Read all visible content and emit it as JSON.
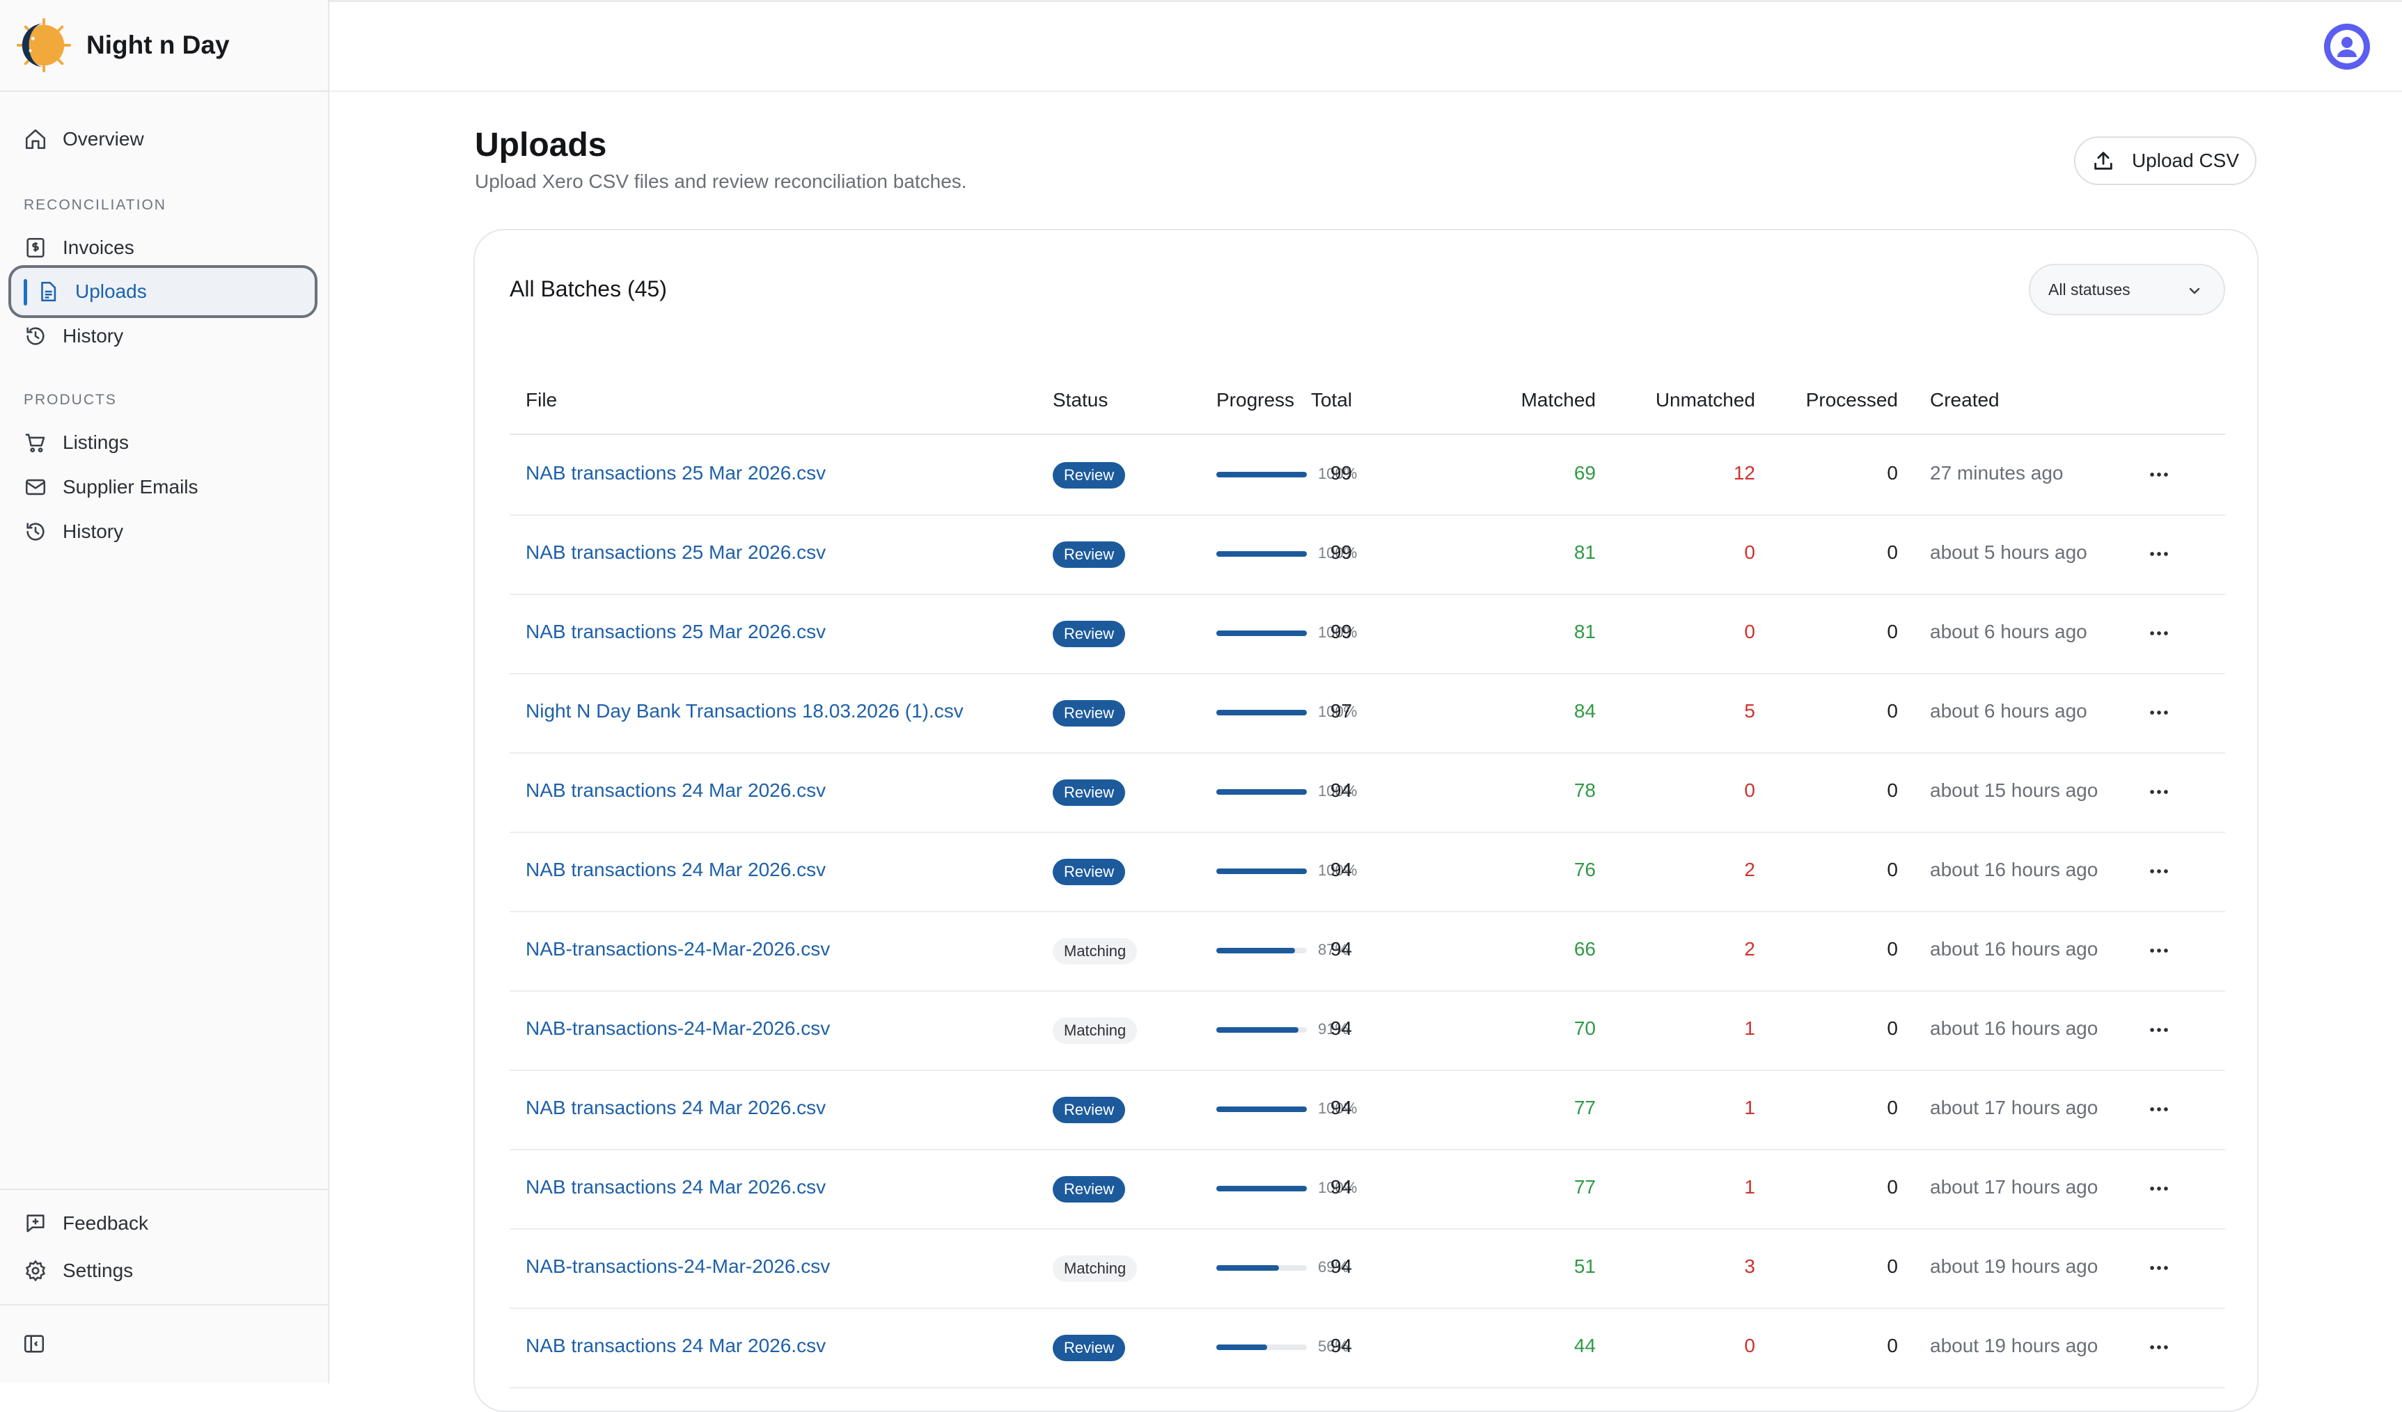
{
  "app": {
    "name": "Night n Day"
  },
  "sidebar": {
    "overview": "Overview",
    "section_reconciliation": "RECONCILIATION",
    "reconciliation_items": [
      {
        "label": "Invoices",
        "icon": "invoice-icon"
      },
      {
        "label": "Uploads",
        "icon": "file-icon",
        "active": true
      },
      {
        "label": "History",
        "icon": "history-icon"
      }
    ],
    "section_products": "PRODUCTS",
    "product_items": [
      {
        "label": "Listings",
        "icon": "cart-icon"
      },
      {
        "label": "Supplier Emails",
        "icon": "mail-icon"
      },
      {
        "label": "History",
        "icon": "history-icon"
      }
    ],
    "feedback": "Feedback",
    "settings": "Settings"
  },
  "page": {
    "title": "Uploads",
    "subtitle": "Upload Xero CSV files and review reconciliation batches.",
    "upload_button": "Upload CSV"
  },
  "batches": {
    "title": "All Batches (45)",
    "filter": "All statuses",
    "columns": {
      "file": "File",
      "status": "Status",
      "progress": "Progress",
      "total": "Total",
      "matched": "Matched",
      "unmatched": "Unmatched",
      "processed": "Processed",
      "created": "Created"
    },
    "rows": [
      {
        "file": "NAB transactions 25 Mar 2026.csv",
        "status": "Review",
        "progress": 100,
        "progress_label": "100%",
        "total": "99",
        "matched": "69",
        "unmatched": "12",
        "processed": "0",
        "created": "27 minutes ago"
      },
      {
        "file": "NAB transactions 25 Mar 2026.csv",
        "status": "Review",
        "progress": 100,
        "progress_label": "100%",
        "total": "99",
        "matched": "81",
        "unmatched": "0",
        "processed": "0",
        "created": "about 5 hours ago"
      },
      {
        "file": "NAB transactions 25 Mar 2026.csv",
        "status": "Review",
        "progress": 100,
        "progress_label": "100%",
        "total": "99",
        "matched": "81",
        "unmatched": "0",
        "processed": "0",
        "created": "about 6 hours ago"
      },
      {
        "file": "Night N Day Bank Transactions 18.03.2026 (1).csv",
        "status": "Review",
        "progress": 100,
        "progress_label": "100%",
        "total": "97",
        "matched": "84",
        "unmatched": "5",
        "processed": "0",
        "created": "about 6 hours ago"
      },
      {
        "file": "NAB transactions 24 Mar 2026.csv",
        "status": "Review",
        "progress": 100,
        "progress_label": "100%",
        "total": "94",
        "matched": "78",
        "unmatched": "0",
        "processed": "0",
        "created": "about 15 hours ago"
      },
      {
        "file": "NAB transactions 24 Mar 2026.csv",
        "status": "Review",
        "progress": 100,
        "progress_label": "100%",
        "total": "94",
        "matched": "76",
        "unmatched": "2",
        "processed": "0",
        "created": "about 16 hours ago"
      },
      {
        "file": "NAB-transactions-24-Mar-2026.csv",
        "status": "Matching",
        "progress": 87,
        "progress_label": "87%",
        "total": "94",
        "matched": "66",
        "unmatched": "2",
        "processed": "0",
        "created": "about 16 hours ago"
      },
      {
        "file": "NAB-transactions-24-Mar-2026.csv",
        "status": "Matching",
        "progress": 91,
        "progress_label": "91%",
        "total": "94",
        "matched": "70",
        "unmatched": "1",
        "processed": "0",
        "created": "about 16 hours ago"
      },
      {
        "file": "NAB transactions 24 Mar 2026.csv",
        "status": "Review",
        "progress": 100,
        "progress_label": "100%",
        "total": "94",
        "matched": "77",
        "unmatched": "1",
        "processed": "0",
        "created": "about 17 hours ago"
      },
      {
        "file": "NAB transactions 24 Mar 2026.csv",
        "status": "Review",
        "progress": 100,
        "progress_label": "100%",
        "total": "94",
        "matched": "77",
        "unmatched": "1",
        "processed": "0",
        "created": "about 17 hours ago"
      },
      {
        "file": "NAB-transactions-24-Mar-2026.csv",
        "status": "Matching",
        "progress": 69,
        "progress_label": "69%",
        "total": "94",
        "matched": "51",
        "unmatched": "3",
        "processed": "0",
        "created": "about 19 hours ago"
      },
      {
        "file": "NAB transactions 24 Mar 2026.csv",
        "status": "Review",
        "progress": 56,
        "progress_label": "56%",
        "total": "94",
        "matched": "44",
        "unmatched": "0",
        "processed": "0",
        "created": "about 19 hours ago"
      }
    ]
  },
  "colors": {
    "accent": "#1c5a9c",
    "link": "#1e60a8",
    "matched": "#2f9a45",
    "unmatched": "#d0312d",
    "avatar": "#5b5ef0"
  }
}
